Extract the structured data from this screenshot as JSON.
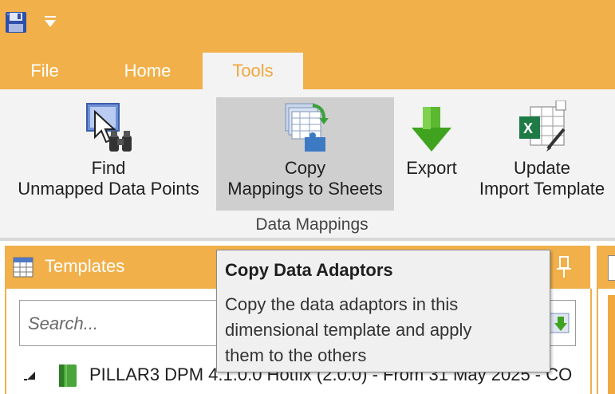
{
  "tabs": [
    {
      "label": "File"
    },
    {
      "label": "Home"
    },
    {
      "label": "Tools"
    }
  ],
  "ribbon": {
    "find_unmapped": {
      "line1": "Find",
      "line2": "Unmapped Data Points"
    },
    "copy_mappings": {
      "line1": "Copy",
      "line2": "Mappings to Sheets"
    },
    "export": {
      "line1": "Export"
    },
    "update_import": {
      "line1": "Update",
      "line2": "Import Template"
    },
    "group_label": "Data Mappings"
  },
  "tooltip": {
    "title": "Copy Data Adaptors",
    "body_lines": [
      "Copy the data adaptors in this",
      "dimensional template and apply",
      "them to the others"
    ]
  },
  "templates_panel": {
    "title": "Templates",
    "search": {
      "placeholder": "Search...",
      "value": ""
    },
    "tree": [
      {
        "label": "PILLAR3 DPM 4.1.0.0 Hotfix (2.0.0) - From 31 May 2025 - CO"
      }
    ]
  },
  "colors": {
    "accent": "#f1b04a",
    "ribbon_bg": "#f3f3f3",
    "selected_button": "#cfcfcf",
    "tooltip_bg": "#f0f0f0"
  },
  "icons": {
    "save": "save-icon",
    "qat_dropdown": "dropdown-arrow-icon",
    "find_unmapped": "cursor-binoculars-icon",
    "copy_mappings": "copy-sheets-icon",
    "export": "export-arrow-icon",
    "update_import": "excel-template-icon",
    "templates": "grid-icon",
    "pin": "pin-icon",
    "search_action": "search-action-icon",
    "tree_expander": "collapse-triangle-icon",
    "tree_item": "book-icon"
  }
}
